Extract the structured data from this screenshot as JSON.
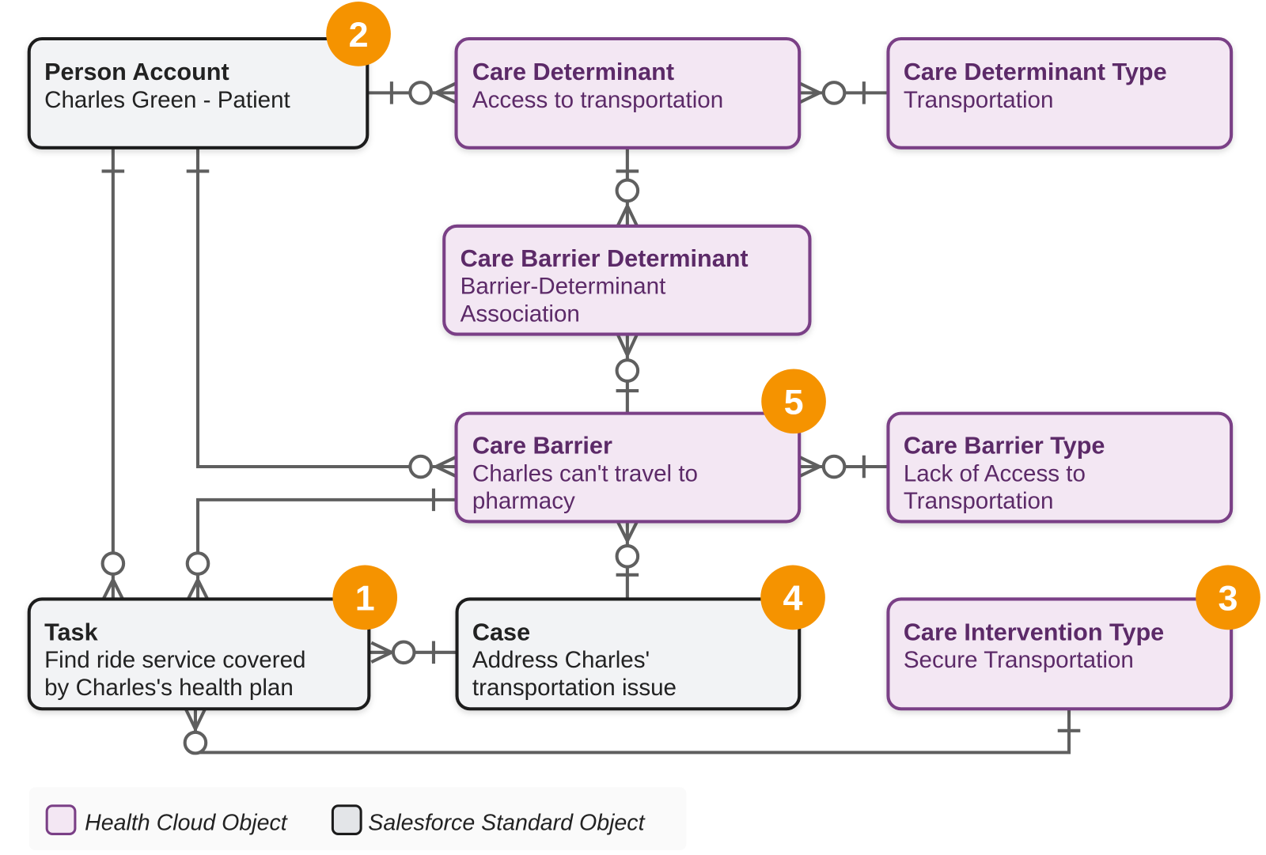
{
  "entities": {
    "person_account": {
      "title": "Person Account",
      "lines": [
        "Charles Green - Patient"
      ],
      "kind": "standard"
    },
    "care_determinant": {
      "title": "Care Determinant",
      "lines": [
        "Access to transportation"
      ],
      "kind": "health-cloud"
    },
    "care_determinant_type": {
      "title": "Care Determinant Type",
      "lines": [
        "Transportation"
      ],
      "kind": "health-cloud"
    },
    "care_barrier_determinant": {
      "title": "Care Barrier Determinant",
      "lines": [
        "Barrier-Determinant",
        "Association"
      ],
      "kind": "health-cloud"
    },
    "care_barrier": {
      "title": "Care Barrier",
      "lines": [
        "Charles can't travel to",
        "pharmacy"
      ],
      "kind": "health-cloud"
    },
    "care_barrier_type": {
      "title": "Care Barrier Type",
      "lines": [
        "Lack of Access to",
        "Transportation"
      ],
      "kind": "health-cloud"
    },
    "task": {
      "title": "Task",
      "lines": [
        "Find ride service covered",
        "by Charles's health plan"
      ],
      "kind": "standard"
    },
    "case": {
      "title": "Case",
      "lines": [
        "Address Charles'",
        "transportation issue"
      ],
      "kind": "standard"
    },
    "care_intervention_type": {
      "title": "Care Intervention Type",
      "lines": [
        "Secure Transportation"
      ],
      "kind": "health-cloud"
    }
  },
  "badges": {
    "task": "1",
    "person_account": "2",
    "care_intervention_type": "3",
    "case": "4",
    "care_barrier": "5"
  },
  "relationships": [
    {
      "from": "Person Account",
      "to": "Care Determinant",
      "type": "one-to-zero-or-many"
    },
    {
      "from": "Care Determinant Type",
      "to": "Care Determinant",
      "type": "one-to-zero-or-many"
    },
    {
      "from": "Care Determinant",
      "to": "Care Barrier Determinant",
      "type": "one-to-zero-or-many"
    },
    {
      "from": "Care Barrier",
      "to": "Care Barrier Determinant",
      "type": "one-to-zero-or-many"
    },
    {
      "from": "Person Account",
      "to": "Care Barrier",
      "type": "one-to-zero-or-many"
    },
    {
      "from": "Care Barrier Type",
      "to": "Care Barrier",
      "type": "one-to-zero-or-many"
    },
    {
      "from": "Person Account",
      "to": "Task",
      "type": "one-to-zero-or-many"
    },
    {
      "from": "Care Barrier",
      "to": "Task",
      "type": "one-to-zero-or-many"
    },
    {
      "from": "Case",
      "to": "Care Barrier",
      "type": "one-to-zero-or-many"
    },
    {
      "from": "Case",
      "to": "Task",
      "type": "one-to-zero-or-many"
    },
    {
      "from": "Care Intervention Type",
      "to": "Task",
      "type": "one-to-zero-or-many"
    }
  ],
  "legend": {
    "health_cloud": "Health Cloud Object",
    "standard": "Salesforce Standard Object"
  },
  "colors": {
    "health_cloud_fill": "#f3e7f3",
    "health_cloud_border": "#7a3f86",
    "standard_fill": "#f2f3f5",
    "standard_border": "#1b1b1b",
    "badge": "#f59300",
    "connector": "#5f5f5f"
  }
}
